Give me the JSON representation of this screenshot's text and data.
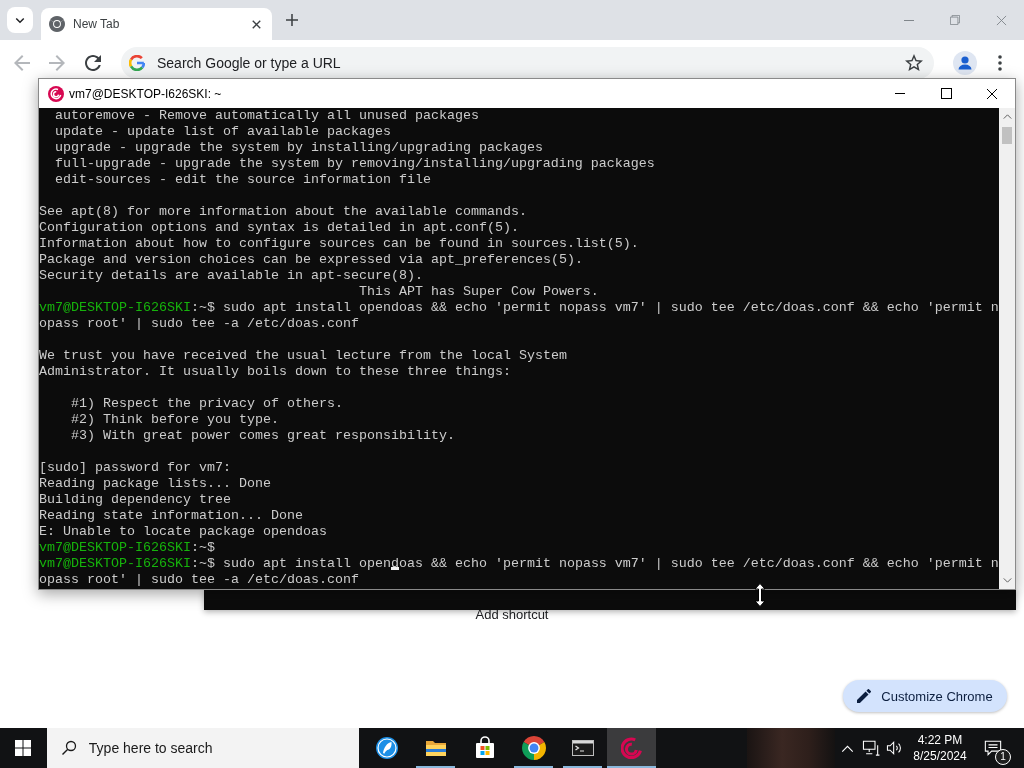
{
  "browser": {
    "tabs": [
      {
        "title": "New Tab",
        "selected": true
      }
    ],
    "omnibox": {
      "placeholder": "Search Google or type a URL"
    },
    "page": {
      "shortcut_label": "Add shortcut",
      "customize_button": "Customize Chrome"
    }
  },
  "terminal": {
    "title": "vm7@DESKTOP-I626SKI: ~",
    "lines": [
      {
        "kind": "option",
        "text": "autoremove - Remove automatically all unused packages"
      },
      {
        "kind": "option",
        "text": "update - update list of available packages"
      },
      {
        "kind": "option",
        "text": "upgrade - upgrade the system by installing/upgrading packages"
      },
      {
        "kind": "option",
        "text": "full-upgrade - upgrade the system by removing/installing/upgrading packages"
      },
      {
        "kind": "option",
        "text": "edit-sources - edit the source information file"
      },
      {
        "kind": "blank"
      },
      {
        "kind": "text",
        "text": "See apt(8) for more information about the available commands."
      },
      {
        "kind": "text",
        "text": "Configuration options and syntax is detailed in apt.conf(5)."
      },
      {
        "kind": "text",
        "text": "Information about how to configure sources can be found in sources.list(5)."
      },
      {
        "kind": "text",
        "text": "Package and version choices can be expressed via apt_preferences(5)."
      },
      {
        "kind": "text",
        "text": "Security details are available in apt-secure(8)."
      },
      {
        "kind": "banner",
        "text": "This APT has Super Cow Powers."
      },
      {
        "kind": "prompt",
        "user_host": "vm7@DESKTOP-I626SKI",
        "path": ":~$",
        "command": [
          {
            "text": "sudo apt install opendoas && echo 'permit nopass vm7' | sudo tee /etc/doas.conf && echo 'permit n",
            "cursor": false
          }
        ]
      },
      {
        "kind": "text",
        "text": "opass root' | sudo tee -a /etc/doas.conf"
      },
      {
        "kind": "blank"
      },
      {
        "kind": "text",
        "text": "We trust you have received the usual lecture from the local System"
      },
      {
        "kind": "text",
        "text": "Administrator. It usually boils down to these three things:"
      },
      {
        "kind": "blank"
      },
      {
        "kind": "rule",
        "text": "#1) Respect the privacy of others."
      },
      {
        "kind": "rule",
        "text": "#2) Think before you type."
      },
      {
        "kind": "rule",
        "text": "#3) With great power comes great responsibility."
      },
      {
        "kind": "blank"
      },
      {
        "kind": "text",
        "text": "[sudo] password for vm7:"
      },
      {
        "kind": "text",
        "text": "Reading package lists... Done"
      },
      {
        "kind": "text",
        "text": "Building dependency tree"
      },
      {
        "kind": "text",
        "text": "Reading state information... Done"
      },
      {
        "kind": "text",
        "text": "E: Unable to locate package opendoas"
      },
      {
        "kind": "prompt",
        "user_host": "vm7@DESKTOP-I626SKI",
        "path": ":~$"
      },
      {
        "kind": "prompt",
        "user_host": "vm7@DESKTOP-I626SKI",
        "path": ":~$",
        "command": [
          {
            "text": "sudo apt install open",
            "cursor": false
          },
          {
            "text": "doas && echo 'permit nopass vm7' | sudo tee /etc/doas.conf && echo 'permit n",
            "cursor": true
          }
        ]
      },
      {
        "kind": "text",
        "text": "opass root' | sudo tee -a /etc/doas.conf"
      }
    ]
  },
  "taskbar": {
    "search_placeholder": "Type here to search",
    "apps": [
      {
        "kind": "feather",
        "running": false,
        "selected": false
      },
      {
        "kind": "folder",
        "running": true,
        "selected": false
      },
      {
        "kind": "store",
        "running": false,
        "selected": false
      },
      {
        "kind": "chrome",
        "running": true,
        "selected": false
      },
      {
        "kind": "terminal",
        "running": true,
        "selected": false
      },
      {
        "kind": "swirl",
        "running": true,
        "selected": true
      }
    ],
    "clock": {
      "time": "4:22 PM",
      "date": "8/25/2024"
    },
    "notification_count": "1"
  }
}
